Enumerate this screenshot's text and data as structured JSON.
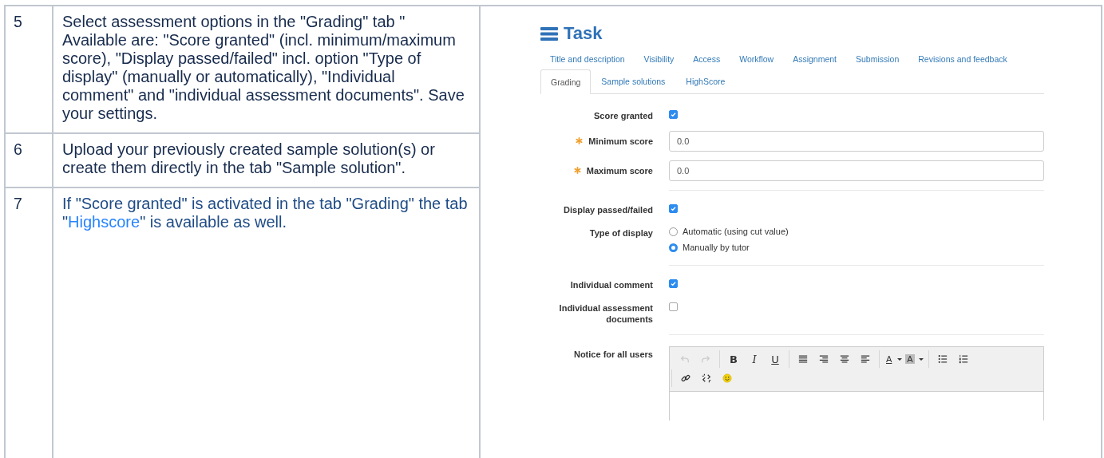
{
  "table": {
    "rows": [
      {
        "number": "5",
        "parts": [
          {
            "text": "Select assessment options in the \"Grading\" tab \" Available are: \"Score granted\" (incl. minimum/maximum score), \"Display passed/failed\" incl. option \"Type of display\" (manually or automatically), \"Individual comment\" and \"individual assessment documents\". Save your settings.",
            "link": false
          }
        ]
      },
      {
        "number": "6",
        "parts": [
          {
            "text": "Upload your previously created sample solution(s) or create them directly in the tab \"Sample solution\".",
            "link": false
          }
        ]
      },
      {
        "number": "7",
        "parts": [
          {
            "text": "If \"Score granted\" is activated in the tab \"Grading\" the tab \"",
            "link": false
          },
          {
            "text": "Highscore",
            "link": true
          },
          {
            "text": "\" is available as well.",
            "link": false
          }
        ]
      }
    ]
  },
  "screenshot": {
    "title": "Task",
    "tab_rows": [
      [
        {
          "label": "Title and description",
          "selected": false
        },
        {
          "label": "Visibility",
          "selected": false
        },
        {
          "label": "Access",
          "selected": false
        },
        {
          "label": "Workflow",
          "selected": false
        },
        {
          "label": "Assignment",
          "selected": false
        },
        {
          "label": "Submission",
          "selected": false
        },
        {
          "label": "Revisions and feedback",
          "selected": false
        }
      ],
      [
        {
          "label": "Grading",
          "selected": true
        },
        {
          "label": "Sample solutions",
          "selected": false
        },
        {
          "label": "HighScore",
          "selected": false
        }
      ]
    ],
    "form": [
      {
        "kind": "checkbox",
        "label": "Score granted",
        "checked": true
      },
      {
        "kind": "input",
        "label": "Minimum score",
        "required": true,
        "value": "0.0"
      },
      {
        "kind": "input",
        "label": "Maximum score",
        "required": true,
        "value": "0.0"
      },
      {
        "kind": "divider"
      },
      {
        "kind": "checkbox",
        "label": "Display passed/failed",
        "checked": true
      },
      {
        "kind": "radio",
        "label": "Type of display",
        "options": [
          {
            "label": "Automatic (using cut value)",
            "selected": false
          },
          {
            "label": "Manually by tutor",
            "selected": true
          }
        ]
      },
      {
        "kind": "divider"
      },
      {
        "kind": "checkbox",
        "label": "Individual comment",
        "checked": true
      },
      {
        "kind": "checkbox",
        "label": "Individual assessment documents",
        "checked": false
      },
      {
        "kind": "divider"
      },
      {
        "kind": "editor",
        "label": "Notice for all users",
        "toolbar": [
          [
            [
              {
                "kind": "undo",
                "disabled": true
              },
              {
                "kind": "redo",
                "disabled": true
              }
            ],
            [
              {
                "kind": "bold",
                "glyph": "B",
                "disabled": false
              },
              {
                "kind": "italic",
                "glyph": "I",
                "disabled": false
              },
              {
                "kind": "underline",
                "glyph": "U",
                "disabled": false
              }
            ],
            [
              {
                "kind": "justify",
                "disabled": false
              },
              {
                "kind": "align-right",
                "disabled": false
              },
              {
                "kind": "align-center",
                "disabled": false
              },
              {
                "kind": "align-left",
                "disabled": false
              }
            ],
            [
              {
                "kind": "text-color",
                "glyph": "A",
                "disabled": false
              },
              {
                "kind": "bg-color",
                "glyph": "A",
                "disabled": false
              }
            ],
            [
              {
                "kind": "bullets",
                "disabled": false
              },
              {
                "kind": "numbers",
                "disabled": false
              }
            ]
          ],
          [
            [
              {
                "kind": "link",
                "disabled": false
              },
              {
                "kind": "unlink",
                "disabled": false
              },
              {
                "kind": "emoji",
                "disabled": false
              }
            ]
          ]
        ]
      }
    ]
  }
}
